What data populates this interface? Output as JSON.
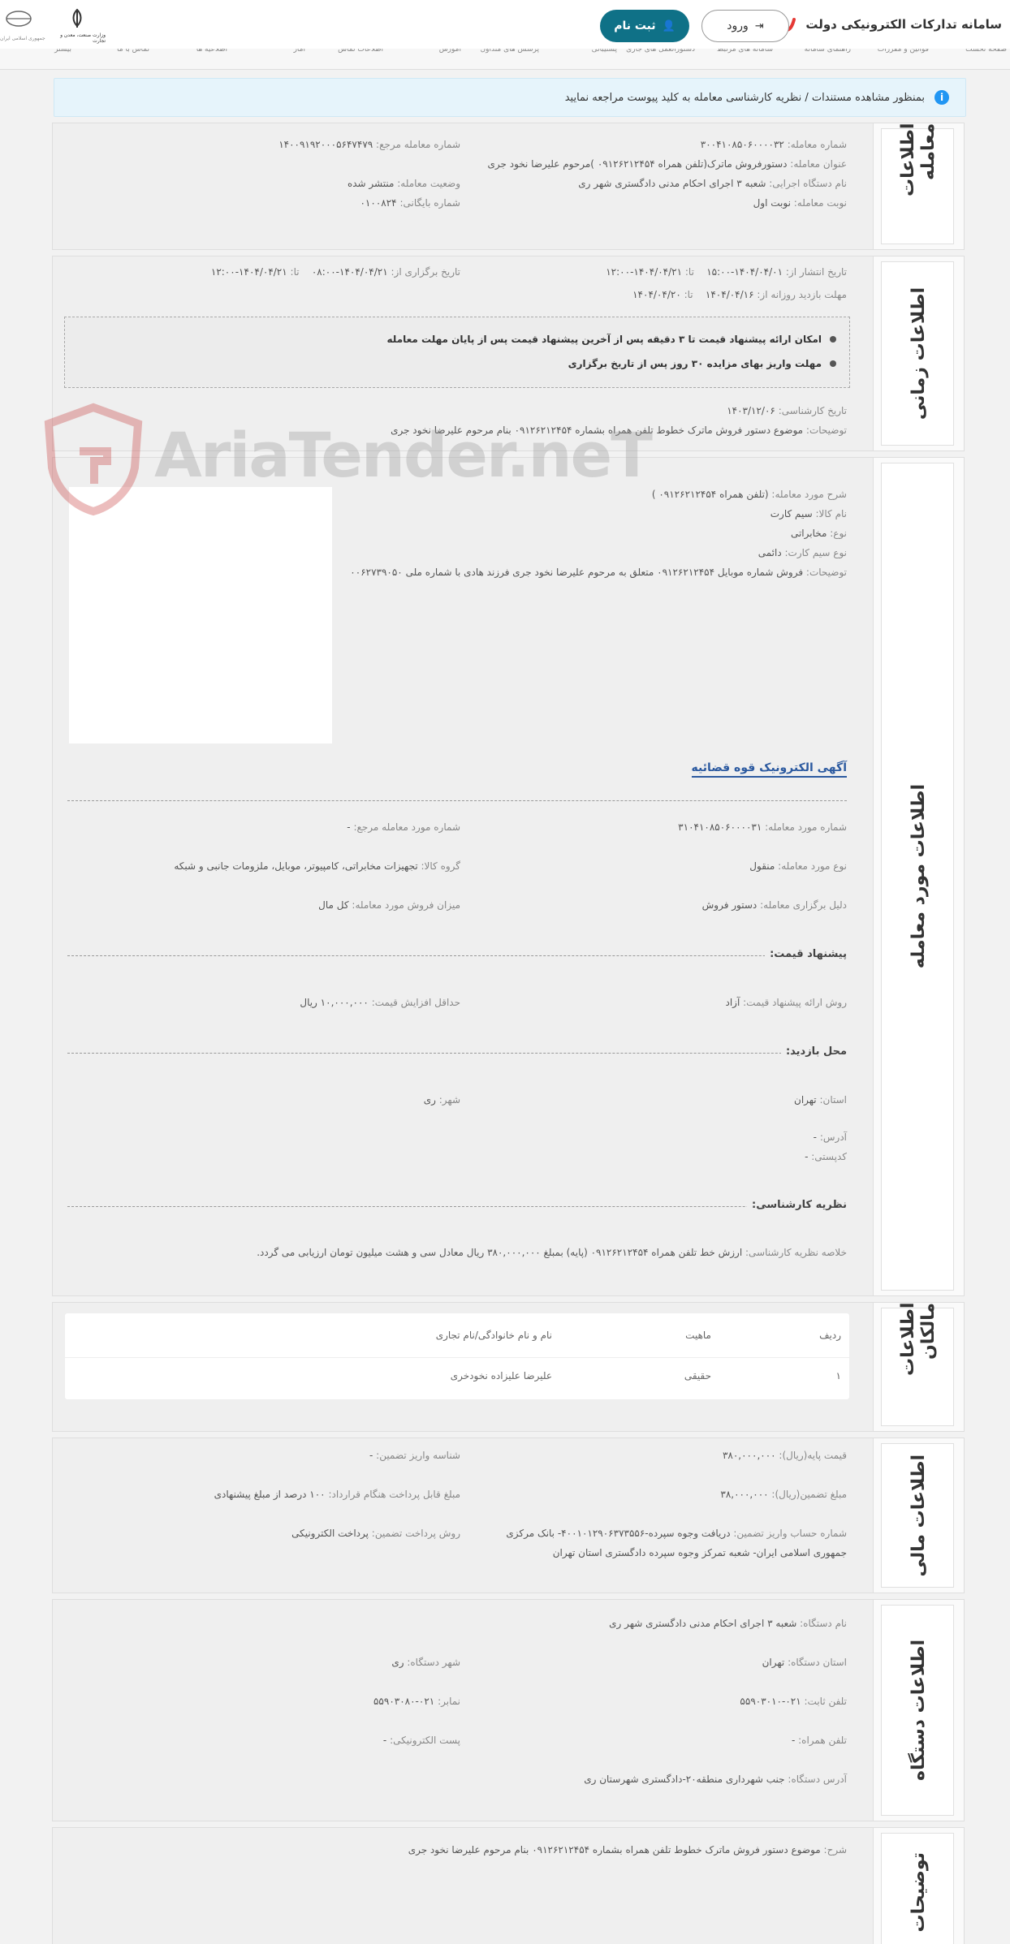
{
  "header": {
    "brand_title": "سامانه تدارکات الکترونیکی دولت",
    "login_label": "ورود",
    "register_label": "ثبت نام",
    "ministry_text": "وزارت صنعت، معدن و تجارت",
    "republic_text": "جمهوری اسلامی ایران"
  },
  "nav": {
    "items": [
      "صفحه نخست",
      "قوانین و مقررات",
      "راهنمای سامانه",
      "سامانه های مرتبط",
      "دستورالعمل های جاری",
      "پشتیبانی",
      "پرسش های متداول",
      "آموزش",
      "اطلاعات تماس",
      "آمار",
      "اطلاعیه ها",
      "تماس با ما",
      "بیشتر"
    ]
  },
  "alert": {
    "text": "بمنظور مشاهده مستندات / نظریه کارشناسی معامله به کلید پیوست مراجعه نمایید"
  },
  "deal_info": {
    "title": "اطلاعات معامله",
    "number_label": "شماره معامله:",
    "number": "۳۰۰۴۱۰۸۵۰۶۰۰۰۰۳۲",
    "ref_label": "شماره معامله مرجع:",
    "ref": "۱۴۰۰۹۱۹۲۰۰۰۵۶۴۷۴۷۹",
    "subject_label": "عنوان معامله:",
    "subject": "دستورفروش ماترک(تلفن همراه ۰۹۱۲۶۲۱۲۴۵۴ )مرحوم علیرضا نخود جری",
    "status_label": "وضعیت معامله:",
    "status": "منتشر شده",
    "org_label": "نام دستگاه اجرایی:",
    "org": "شعبه ۳ اجرای احکام مدنی دادگستری شهر ری",
    "archive_label": "شماره بایگانی:",
    "archive": "۰۱۰۰۸۲۴",
    "turn_label": "نوبت معامله:",
    "turn": "نوبت اول"
  },
  "time_info": {
    "title": "اطلاعات زمانی",
    "publish_label": "تاریخ انتشار از:",
    "publish_from": "۱۴۰۴/۰۴/۰۱-۱۵:۰۰",
    "to_label": "تا:",
    "publish_to": "۱۴۰۴/۰۴/۲۱-۱۲:۰۰",
    "hold_label": "تاریخ برگزاری از:",
    "hold_from": "۱۴۰۴/۰۴/۲۱-۰۸:۰۰",
    "hold_to": "۱۴۰۴/۰۴/۲۱-۱۲:۰۰",
    "visit_label": "مهلت بازدید روزانه از:",
    "visit_from": "۱۴۰۴/۰۴/۱۶",
    "visit_to": "۱۴۰۴/۰۴/۲۰",
    "note1": "امکان ارائه پیشنهاد قیمت تا ۳ دقیقه پس از آخرین پیشنهاد قیمت پس از پایان مهلت معامله",
    "note2": "مهلت واریز بهای مزایده ۳۰ روز پس از تاریخ برگزاری",
    "expert_date_label": "تاریخ کارشناسی:",
    "expert_date": "۱۴۰۳/۱۲/۰۶",
    "desc_label": "توضیحات:",
    "desc": "موضوع دستور فروش ماترک خطوط تلفن همراه بشماره ۰۹۱۲۶۲۱۲۴۵۴ بنام مرحوم علیرضا نخود جری"
  },
  "item_info": {
    "title": "اطلاعات مورد معامله",
    "item_desc_label": "شرح مورد معامله:",
    "item_desc": "(تلفن همراه ۰۹۱۲۶۲۱۲۴۵۴ )",
    "goods_label": "نام کالا:",
    "goods": "سیم کارت",
    "type_label": "نوع:",
    "type": "مخابراتی",
    "sim_label": "نوع سیم کارت:",
    "sim": "دائمی",
    "desc_label": "توضیحات:",
    "desc": "فروش شماره موبایل ۰۹۱۲۶۲۱۲۴۵۴ متعلق به مرحوم علیرضا نخود جری فرزند هادی با شماره ملی ۰۰۶۲۷۳۹۰۵۰",
    "ad_link": "آگهی الکترونیک قوه قضائیه",
    "item_no_label": "شماره مورد معامله:",
    "item_no": "۳۱۰۴۱۰۸۵۰۶۰۰۰۰۳۱",
    "ref_item_label": "شماره مورد معامله مرجع:",
    "ref_item": "-",
    "kind_label": "نوع مورد معامله:",
    "kind": "منقول",
    "group_label": "گروه کالا:",
    "group": "تجهیزات مخابراتی، کامپیوتر، موبایل، ملزومات جانبی و شبکه",
    "reason_label": "دلیل برگزاری معامله:",
    "reason": "دستور فروش",
    "amount_label": "میزان فروش مورد معامله:",
    "amount": "کل مال",
    "price_offer_head": "پیشنهاد قیمت:",
    "method_label": "روش ارائه پیشنهاد قیمت:",
    "method": "آزاد",
    "min_inc_label": "حداقل افزایش قیمت:",
    "min_inc": "۱۰,۰۰۰,۰۰۰ ریال",
    "visit_head": "محل بازدید:",
    "province_label": "استان:",
    "province": "تهران",
    "city_label": "شهر:",
    "city": "ری",
    "address_label": "آدرس:",
    "address": "-",
    "postal_label": "کدپستی:",
    "postal": "-",
    "expert_head": "نظریه کارشناسی:",
    "expert_sum_label": "خلاصه نظریه کارشناسی:",
    "expert_sum": "ارزش خط تلفن همراه ۰۹۱۲۶۲۱۲۴۵۴ (پایه) بمبلغ ۳۸۰,۰۰۰,۰۰۰ ریال معادل سی و هشت میلیون تومان ارزیابی می گردد."
  },
  "owners": {
    "title": "اطلاعات مالکان",
    "headers": [
      "ردیف",
      "ماهیت",
      "نام و نام خانوادگی/نام تجاری"
    ],
    "rows": [
      [
        "۱",
        "حقیقی",
        "علیرضا علیزاده نخودخری"
      ]
    ]
  },
  "finance": {
    "title": "اطلاعات مالی",
    "base_label": "قیمت پایه(ریال):",
    "base": "۳۸۰,۰۰۰,۰۰۰",
    "dep_id_label": "شناسه واریز تضمین:",
    "dep_id": "-",
    "guarantee_label": "مبلغ تضمین(ریال):",
    "guarantee": "۳۸,۰۰۰,۰۰۰",
    "payable_label": "مبلغ قابل پرداخت هنگام قرارداد:",
    "payable": "۱۰۰ درصد از مبلغ پیشنهادی",
    "account_label": "شماره حساب واریز تضمین:",
    "account": "دریافت وجوه سپرده-۴۰۰۱۰۱۲۹۰۶۳۷۳۵۵۶- بانک مرکزی",
    "account2": "جمهوری اسلامی ایران- شعبه تمرکز وجوه سپرده دادگستری استان تهران",
    "paymethod_label": "روش پرداخت تضمین:",
    "paymethod": "پرداخت الکترونیکی"
  },
  "org_info": {
    "title": "اطلاعات دستگاه",
    "name_label": "نام دستگاه:",
    "name": "شعبه ۳ اجرای احکام مدنی دادگستری شهر ری",
    "province_label": "استان دستگاه:",
    "province": "تهران",
    "city_label": "شهر دستگاه:",
    "city": "ری",
    "phone_label": "تلفن ثابت:",
    "phone": "۰۲۱-۵۵۹۰۳۰۱۰",
    "fax_label": "نمابر:",
    "fax": "۰۲۱-۵۵۹۰۳۰۸۰",
    "mobile_label": "تلفن همراه:",
    "mobile": "-",
    "email_label": "پست الکترونیکی:",
    "email": "-",
    "address_label": "آدرس دستگاه:",
    "address": "جنب شهرداری منطقه۲۰-دادگستری شهرستان ری"
  },
  "notes": {
    "title": "توضیحات",
    "desc_label": "شرح:",
    "desc": "موضوع دستور فروش ماترک خطوط تلفن همراه بشماره ۰۹۱۲۶۲۱۲۴۵۴ بنام مرحوم علیرضا نخود جری"
  },
  "watermark": {
    "text": "AriaTender.neT"
  },
  "colors": {
    "primary": "#0f7187",
    "link": "#2c5aa0",
    "alert_bg": "#e6f4fb",
    "info": "#2196f3"
  }
}
